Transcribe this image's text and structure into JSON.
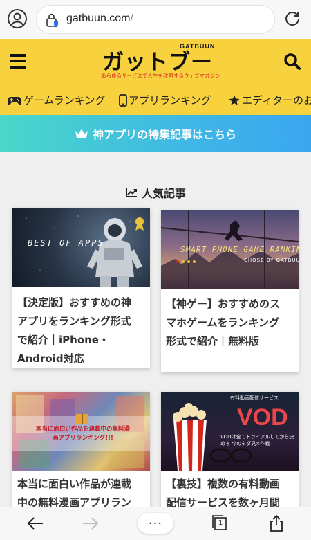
{
  "browser": {
    "url": "gatbuun.com",
    "url_suffix": "/"
  },
  "header": {
    "logo_main": "ガットブーン",
    "logo_sub": "GATBUUN",
    "logo_tagline": "あらゆるサービスで人生を攻略するウェブマガジン"
  },
  "categories": [
    {
      "label": "ゲームランキング",
      "icon": "gamepad-icon"
    },
    {
      "label": "アプリランキング",
      "icon": "smartphone-icon"
    },
    {
      "label": "エディターのお",
      "icon": "star-icon"
    }
  ],
  "banner": {
    "label": "神アプリの特集記事はこちら",
    "icon": "crown-icon"
  },
  "section": {
    "title": "人気記事",
    "icon": "trend-chart-icon"
  },
  "articles": [
    {
      "title_lines": [
        "【決定版】おすすめの神",
        "アプリをランキング形式",
        "で紹介｜iPhone・",
        "Android対応"
      ],
      "thumb_text": "BEST OF APPS"
    },
    {
      "title_lines": [
        "【神ゲー】おすすめのス",
        "マホゲームをランキング",
        "形式で紹介｜無料版"
      ],
      "thumb_text": "SMART PHONE GAME RANKING",
      "thumb_sub": "CHOSE BY GATBUUN"
    },
    {
      "title_lines": [
        "本当に面白い作品が連載",
        "中の無料漫画アプリラン"
      ],
      "thumb_text": "本当に面白い作品を連載中の無料漫画アプリランキング!!!"
    },
    {
      "title_lines": [
        "【裏技】複数の有料動画",
        "配信サービスを数ヶ月間"
      ],
      "thumb_text": "VOD",
      "thumb_top": "有料動画配信サービス",
      "thumb_sub": "VODは全てトライアルしてから決めろ 今のタダ見×作戦"
    }
  ],
  "toolbar": {
    "more_label": "···",
    "tab_count": "1"
  }
}
